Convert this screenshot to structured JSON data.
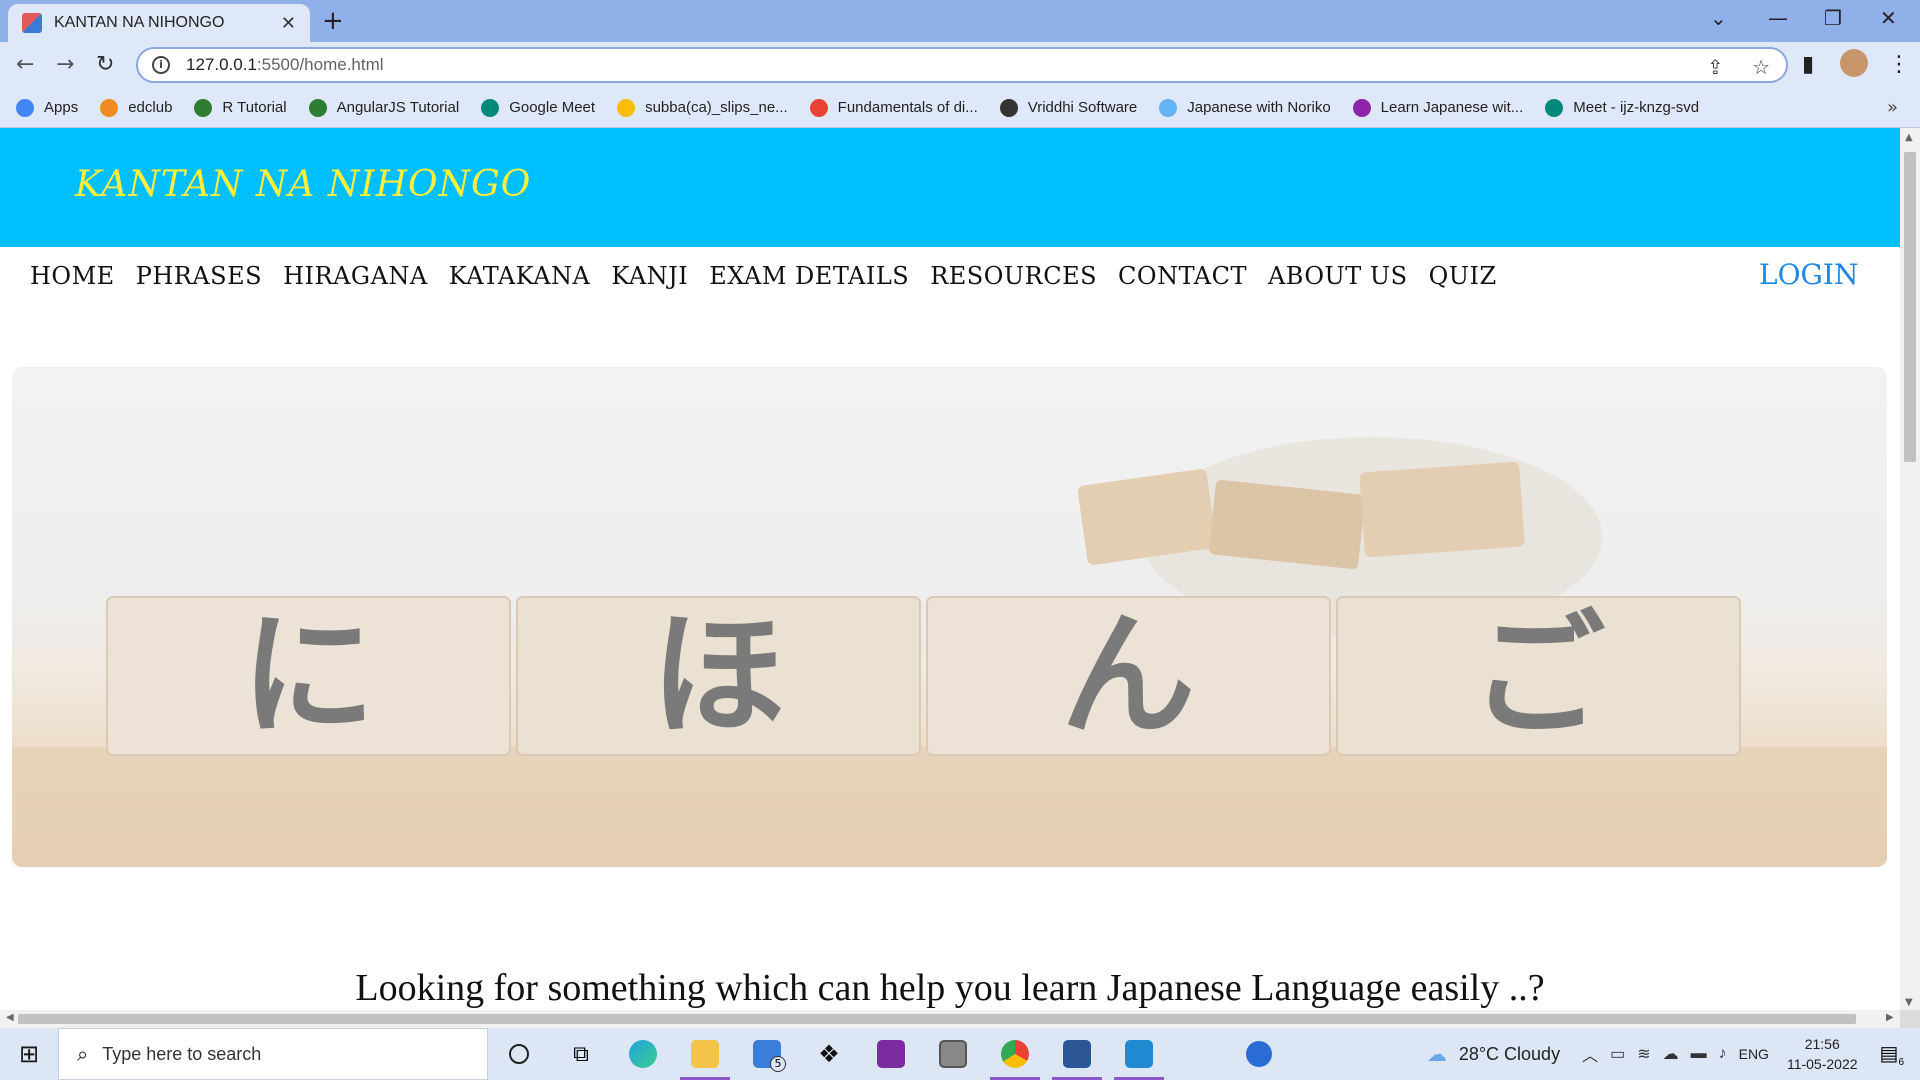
{
  "browser": {
    "tab_title": "KANTAN NA NIHONGO",
    "url_host": "127.0.0.1",
    "url_path": ":5500/home.html",
    "bookmarks": [
      {
        "label": "Apps",
        "color": "#4285f4"
      },
      {
        "label": "edclub",
        "color": "#f08a24"
      },
      {
        "label": "R Tutorial",
        "color": "#2e7d32"
      },
      {
        "label": "AngularJS Tutorial",
        "color": "#2e7d32"
      },
      {
        "label": "Google Meet",
        "color": "#00897b"
      },
      {
        "label": "subba(ca)_slips_ne...",
        "color": "#fbbc04"
      },
      {
        "label": "Fundamentals of di...",
        "color": "#ea4335"
      },
      {
        "label": "Vriddhi Software",
        "color": "#333333"
      },
      {
        "label": "Japanese with Noriko",
        "color": "#64b5f6"
      },
      {
        "label": "Learn Japanese wit...",
        "color": "#8e24aa"
      },
      {
        "label": "Meet - ijz-knzg-svd",
        "color": "#00897b"
      }
    ]
  },
  "site": {
    "brand": "KANTAN NA NIHONGO",
    "nav": [
      "HOME",
      "PHRASES",
      "HIRAGANA",
      "KATAKANA",
      "KANJI",
      "EXAM DETAILS",
      "RESOURCES",
      "CONTACT",
      "ABOUT US",
      "QUIZ"
    ],
    "login": "LOGIN",
    "hero_blocks": [
      "に",
      "ほ",
      "ん",
      "ご"
    ],
    "tagline": "Looking for something which can help you learn Japanese Language easily ..?"
  },
  "taskbar": {
    "search_placeholder": "Type here to search",
    "weather": "28°C  Cloudy",
    "lang": "ENG",
    "time": "21:56",
    "date": "11-05-2022",
    "mail_badge": "5",
    "notif_count": "6"
  },
  "colors": {
    "header_bg": "#00bfff",
    "brand_text": "#ffef3b",
    "login_text": "#1e88e5"
  }
}
